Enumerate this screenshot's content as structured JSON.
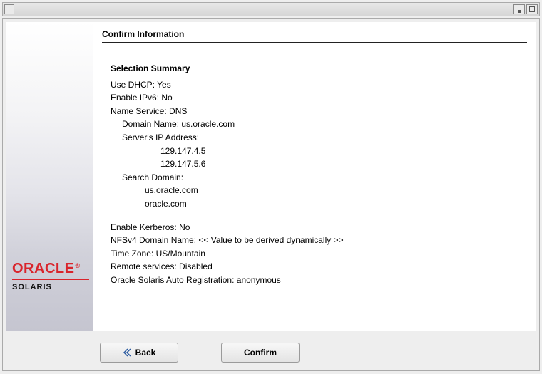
{
  "page": {
    "title": "Confirm Information",
    "summary_heading": "Selection Summary"
  },
  "branding": {
    "vendor": "ORACLE",
    "registered": "®",
    "product": "SOLARIS"
  },
  "summary": {
    "use_dhcp": {
      "label": "Use DHCP",
      "value": "Yes"
    },
    "enable_ipv6": {
      "label": "Enable IPv6",
      "value": "No"
    },
    "name_service": {
      "label": "Name Service",
      "value": "DNS"
    },
    "domain_name": {
      "label": "Domain Name",
      "value": "us.oracle.com"
    },
    "server_ip_label": "Server's IP Address:",
    "server_ips": [
      "129.147.4.5",
      "129.147.5.6"
    ],
    "search_domain_label": "Search Domain:",
    "search_domains": [
      "us.oracle.com",
      "oracle.com"
    ],
    "enable_kerberos": {
      "label": "Enable Kerberos",
      "value": "No"
    },
    "nfsv4": {
      "label": "NFSv4 Domain Name",
      "value": "<< Value to be derived dynamically >>"
    },
    "time_zone": {
      "label": "Time Zone",
      "value": "US/Mountain"
    },
    "remote_services": {
      "label": "Remote services",
      "value": "Disabled"
    },
    "auto_reg": {
      "label": "Oracle Solaris Auto Registration",
      "value": "anonymous"
    }
  },
  "buttons": {
    "back": "Back",
    "confirm": "Confirm"
  }
}
